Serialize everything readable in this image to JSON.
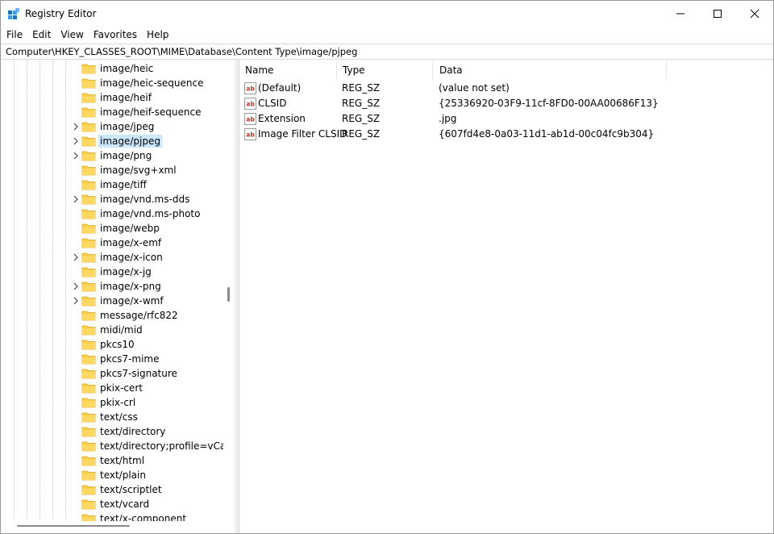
{
  "window": {
    "title": "Registry Editor",
    "icon": "registry-editor-icon",
    "controls": [
      "minimize-icon",
      "maximize-icon",
      "close-icon"
    ]
  },
  "menu": [
    "File",
    "Edit",
    "View",
    "Favorites",
    "Help"
  ],
  "address": "Computer\\HKEY_CLASSES_ROOT\\MIME\\Database\\Content Type\\image/pjpeg",
  "tree": {
    "items": [
      {
        "label": "image/heic",
        "expandable": false,
        "selected": false
      },
      {
        "label": "image/heic-sequence",
        "expandable": false,
        "selected": false
      },
      {
        "label": "image/heif",
        "expandable": false,
        "selected": false
      },
      {
        "label": "image/heif-sequence",
        "expandable": false,
        "selected": false
      },
      {
        "label": "image/jpeg",
        "expandable": true,
        "selected": false
      },
      {
        "label": "image/pjpeg",
        "expandable": true,
        "selected": true
      },
      {
        "label": "image/png",
        "expandable": true,
        "selected": false
      },
      {
        "label": "image/svg+xml",
        "expandable": false,
        "selected": false
      },
      {
        "label": "image/tiff",
        "expandable": false,
        "selected": false
      },
      {
        "label": "image/vnd.ms-dds",
        "expandable": true,
        "selected": false
      },
      {
        "label": "image/vnd.ms-photo",
        "expandable": false,
        "selected": false
      },
      {
        "label": "image/webp",
        "expandable": false,
        "selected": false
      },
      {
        "label": "image/x-emf",
        "expandable": false,
        "selected": false
      },
      {
        "label": "image/x-icon",
        "expandable": true,
        "selected": false
      },
      {
        "label": "image/x-jg",
        "expandable": false,
        "selected": false
      },
      {
        "label": "image/x-png",
        "expandable": true,
        "selected": false
      },
      {
        "label": "image/x-wmf",
        "expandable": true,
        "selected": false
      },
      {
        "label": "message/rfc822",
        "expandable": false,
        "selected": false
      },
      {
        "label": "midi/mid",
        "expandable": false,
        "selected": false
      },
      {
        "label": "pkcs10",
        "expandable": false,
        "selected": false
      },
      {
        "label": "pkcs7-mime",
        "expandable": false,
        "selected": false
      },
      {
        "label": "pkcs7-signature",
        "expandable": false,
        "selected": false
      },
      {
        "label": "pkix-cert",
        "expandable": false,
        "selected": false
      },
      {
        "label": "pkix-crl",
        "expandable": false,
        "selected": false
      },
      {
        "label": "text/css",
        "expandable": false,
        "selected": false
      },
      {
        "label": "text/directory",
        "expandable": false,
        "selected": false
      },
      {
        "label": "text/directory;profile=vCard",
        "expandable": false,
        "selected": false
      },
      {
        "label": "text/html",
        "expandable": false,
        "selected": false
      },
      {
        "label": "text/plain",
        "expandable": false,
        "selected": false
      },
      {
        "label": "text/scriptlet",
        "expandable": false,
        "selected": false
      },
      {
        "label": "text/vcard",
        "expandable": false,
        "selected": false
      },
      {
        "label": "text/x-component",
        "expandable": false,
        "selected": false
      }
    ]
  },
  "values": {
    "columns": {
      "name": "Name",
      "type": "Type",
      "data": "Data"
    },
    "rows": [
      {
        "name": "(Default)",
        "type": "REG_SZ",
        "data": "(value not set)"
      },
      {
        "name": "CLSID",
        "type": "REG_SZ",
        "data": "{25336920-03F9-11cf-8FD0-00AA00686F13}"
      },
      {
        "name": "Extension",
        "type": "REG_SZ",
        "data": ".jpg"
      },
      {
        "name": "Image Filter CLSID",
        "type": "REG_SZ",
        "data": "{607fd4e8-0a03-11d1-ab1d-00c04fc9b304}"
      }
    ]
  },
  "colors": {
    "selection": "#cce8ff",
    "folder": "#ffcf48",
    "string_icon": "#c0392b"
  }
}
